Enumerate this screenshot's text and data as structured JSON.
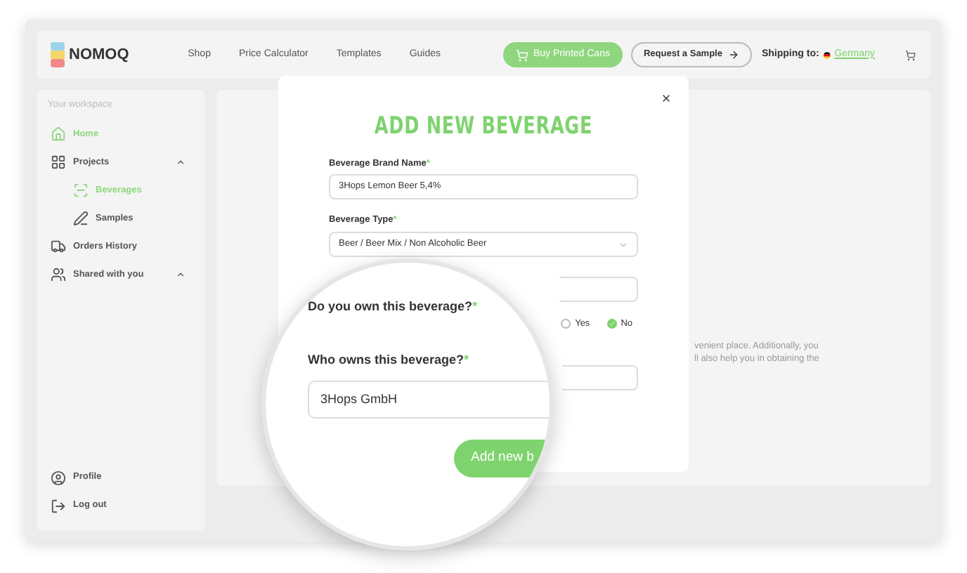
{
  "header": {
    "logo": "NOMOQ",
    "nav": [
      "Shop",
      "Price Calculator",
      "Templates",
      "Guides"
    ],
    "buy_button": "Buy Printed Cans",
    "sample_button": "Request a Sample",
    "shipping_label": "Shipping to:",
    "shipping_country": "Germany"
  },
  "sidebar": {
    "heading": "Your workspace",
    "items": [
      {
        "label": "Home",
        "selected": true
      },
      {
        "label": "Projects",
        "selected": false,
        "expanded": true,
        "children": [
          {
            "label": "Beverages",
            "selected": true
          },
          {
            "label": "Samples",
            "selected": false
          }
        ]
      },
      {
        "label": "Orders History",
        "selected": false
      },
      {
        "label": "Shared with you",
        "selected": false,
        "expanded": true
      }
    ],
    "bottom": [
      {
        "label": "Profile"
      },
      {
        "label": "Log out"
      }
    ]
  },
  "main": {
    "text_lines": [
      "venient place. Additionally, you",
      "ll also help you in obtaining the"
    ]
  },
  "modal": {
    "title": "ADD NEW BEVERAGE",
    "brand_label": {
      "text": "Beverage Brand Name",
      "mark": "*"
    },
    "brand_value": "3Hops Lemon Beer 5,4%",
    "type_label": {
      "text": "Beverage Type",
      "mark": "*"
    },
    "type_value": "Beer / Beer Mix / Non Alcoholic Beer",
    "ownership": [
      {
        "label": "Yes",
        "selected": false
      },
      {
        "label": "No",
        "selected": true
      }
    ]
  },
  "magnifier": {
    "own_label": {
      "text": "Do you own this beverage?",
      "mark": "*"
    },
    "owner_label": {
      "text": "Who owns this beverage?",
      "mark": "*"
    },
    "owner_value": "3Hops GmbH",
    "submit": "Add new b"
  }
}
